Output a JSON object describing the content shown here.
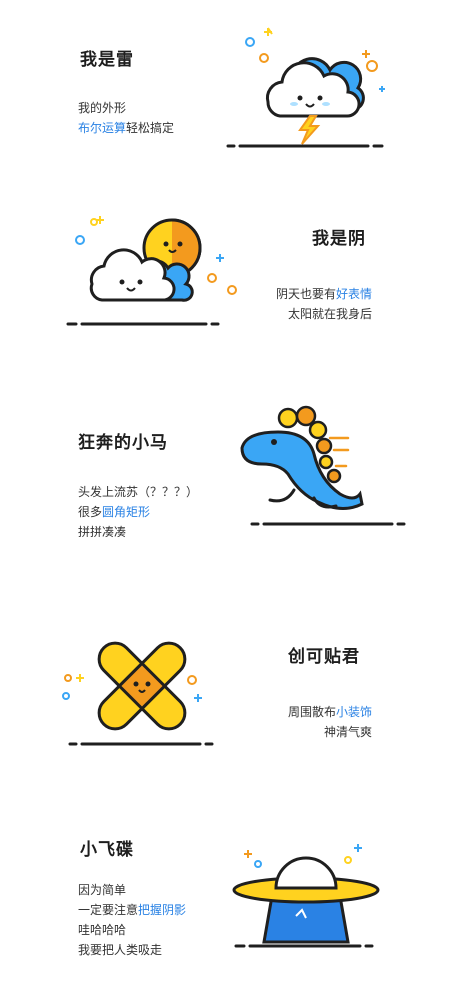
{
  "sections": [
    {
      "title": "我是雷",
      "lines": [
        [
          {
            "t": "我的外形",
            "hl": false
          }
        ],
        [
          {
            "t": "布尔运算",
            "hl": true
          },
          {
            "t": "轻松搞定",
            "hl": false
          }
        ]
      ]
    },
    {
      "title": "我是阴",
      "lines": [
        [
          {
            "t": "阴天也要有",
            "hl": false
          },
          {
            "t": "好表情",
            "hl": true
          }
        ],
        [
          {
            "t": "太阳就在我身后",
            "hl": false
          }
        ]
      ]
    },
    {
      "title": "狂奔的小马",
      "lines": [
        [
          {
            "t": "头发上流苏（？？？）",
            "hl": false
          }
        ],
        [
          {
            "t": "很多",
            "hl": false
          },
          {
            "t": "圆角矩形",
            "hl": true
          }
        ],
        [
          {
            "t": "拼拼凑凑",
            "hl": false
          }
        ]
      ]
    },
    {
      "title": "创可贴君",
      "lines": [
        [
          {
            "t": "周围散布",
            "hl": false
          },
          {
            "t": "小装饰",
            "hl": true
          }
        ],
        [
          {
            "t": "神清气爽",
            "hl": false
          }
        ]
      ]
    },
    {
      "title": "小飞碟",
      "lines": [
        [
          {
            "t": "因为简单",
            "hl": false
          }
        ],
        [
          {
            "t": "一定要注意",
            "hl": false
          },
          {
            "t": "把握阴影",
            "hl": true
          }
        ],
        [
          {
            "t": "哇哈哈哈",
            "hl": false
          }
        ],
        [
          {
            "t": "我要把人类吸走",
            "hl": false
          }
        ]
      ]
    }
  ],
  "icons": [
    "thunder-cloud-icon",
    "cloud-sun-icon",
    "dinosaur-horse-icon",
    "bandage-icon",
    "ufo-icon"
  ],
  "colors": {
    "accent": "#2a82e4",
    "yellow": "#ffd21f",
    "orange": "#f39a1e",
    "blue": "#3aa6f5",
    "outline": "#1f1f1f"
  }
}
